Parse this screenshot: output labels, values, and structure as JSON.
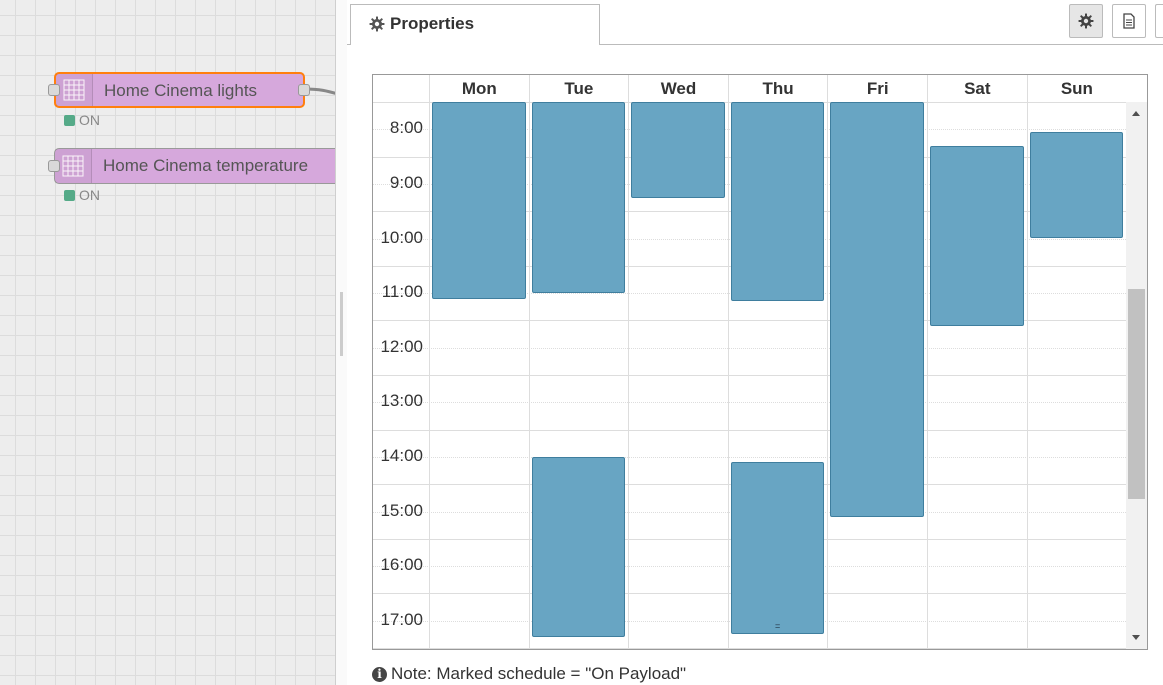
{
  "flow": {
    "nodes": [
      {
        "label": "Home Cinema lights",
        "status": "ON",
        "selected": true,
        "icon": "calendar-grid-icon"
      },
      {
        "label": "Home Cinema temperature",
        "status": "ON",
        "selected": false,
        "icon": "calendar-grid-icon"
      }
    ]
  },
  "sidebar": {
    "tab_label": "Properties",
    "tab_icon": "gear-icon",
    "toolbar": [
      {
        "icon": "gear-icon",
        "active": true
      },
      {
        "icon": "document-icon",
        "active": false
      }
    ]
  },
  "schedule": {
    "days": [
      "Mon",
      "Tue",
      "Wed",
      "Thu",
      "Fri",
      "Sat",
      "Sun"
    ],
    "times": [
      "8:00",
      "9:00",
      "10:00",
      "11:00",
      "12:00",
      "13:00",
      "14:00",
      "15:00",
      "16:00",
      "17:00"
    ],
    "visible_hours": {
      "start": 7.5,
      "end": 17.5
    },
    "color": "#68a5c3",
    "blocks": [
      {
        "day": "Mon",
        "start": 7.5,
        "end": 11.1
      },
      {
        "day": "Tue",
        "start": 7.5,
        "end": 11.0
      },
      {
        "day": "Tue",
        "start": 14.0,
        "end": 17.3
      },
      {
        "day": "Wed",
        "start": 7.5,
        "end": 9.25
      },
      {
        "day": "Thu",
        "start": 7.5,
        "end": 11.15
      },
      {
        "day": "Thu",
        "start": 14.1,
        "end": 17.25,
        "handle": "="
      },
      {
        "day": "Fri",
        "start": 7.5,
        "end": 15.1
      },
      {
        "day": "Sat",
        "start": 8.3,
        "end": 11.6
      },
      {
        "day": "Sun",
        "start": 8.05,
        "end": 10.0
      }
    ],
    "scroll": {
      "position": 0.33,
      "visible_fraction": 0.4
    }
  },
  "note": "Note: Marked schedule = \"On Payload\""
}
